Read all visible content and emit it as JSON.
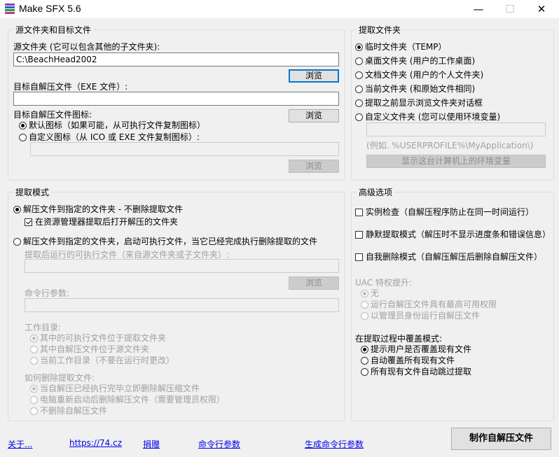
{
  "window": {
    "title": "Make SFX 5.6",
    "minimize_glyph": "—",
    "maximize_glyph": "☐",
    "close_glyph": "✕",
    "icon": "winrar-books-icon"
  },
  "source_group": {
    "legend": "源文件夹和目标文件",
    "source_label": "源文件夹 (它可以包含其他的子文件夹):",
    "source_value": "C:\\BeachHead2002",
    "browse1": "浏览",
    "target_label": "目标自解压文件（EXE 文件）:",
    "target_value": "",
    "browse2": "浏览",
    "icon_label": "目标自解压文件图标:",
    "icon_default": "默认图标（如果可能，从可执行文件复制图标）",
    "icon_custom": "自定义图标（从 ICO 或 EXE 文件复制图标）:",
    "icon_path": "",
    "browse3": "浏览"
  },
  "extract_folder": {
    "legend": "提取文件夹",
    "options": [
      "临时文件夹（TEMP）",
      "桌面文件夹 (用户的工作桌面)",
      "文档文件夹 (用户的个人文件夹)",
      "当前文件夹 (和原始文件相同)",
      "提取之前显示浏览文件夹对话框",
      "自定义文件夹 (您可以使用环境变量)"
    ],
    "custom_path": "",
    "example": "(例如. %USERPROFILE%\\MyApplication\\)",
    "env_button": "显示这台计算机上的环境变量"
  },
  "extract_mode": {
    "legend": "提取模式",
    "mode1": "解压文件到指定的文件夹 - 不删除提取文件",
    "open_folder": "在资源管理器提取后打开解压的文件夹",
    "mode2": "解压文件到指定的文件夹，启动可执行文件，当它已经完成执行删除提取的文件",
    "exe_label": "提取后运行的可执行文件（来自源文件夹或子文件夹）:",
    "exe_value": "",
    "browse4": "浏览",
    "cmd_label": "命令行参数:",
    "cmd_value": "",
    "workdir_label": "工作目录:",
    "workdir_options": [
      "其中的可执行文件位于提取文件夹",
      "其中自解压文件位于源文件夹",
      "当前工作目录（不要在运行时更改）"
    ],
    "delete_label": "如何删除提取文件:",
    "delete_options": [
      "当自解压已经执行完毕立即删除解压缩文件",
      "电脑重新启动后删除解压文件（需要管理员权限）",
      "不删除自解压文件"
    ]
  },
  "advanced": {
    "legend": "高级选项",
    "single_instance": "实例检查（自解压程序防止在同一时间运行）",
    "silent": "静默提取模式（解压时不显示进度条和错误信息）",
    "self_delete": "自我删除模式（自解压解压后删除自解压文件）",
    "uac_label": "UAC 特权提升:",
    "uac_options": [
      "无",
      "运行自解压文件具有最高可用权限",
      "以管理员身份运行自解压文件"
    ],
    "overwrite_label": "在提取过程中覆盖模式:",
    "overwrite_options": [
      "提示用户是否覆盖现有文件",
      "自动覆盖所有现有文件",
      "所有现有文件自动跳过提取"
    ]
  },
  "footer": {
    "about": "关于...",
    "website": "https://74.cz",
    "donate": "捐赠",
    "cmdline": "命令行参数",
    "gen_cmd": "生成命令行参数",
    "make": "制作自解压文件"
  },
  "colors": {
    "accent": "#0078d7",
    "link": "#0000ee"
  }
}
